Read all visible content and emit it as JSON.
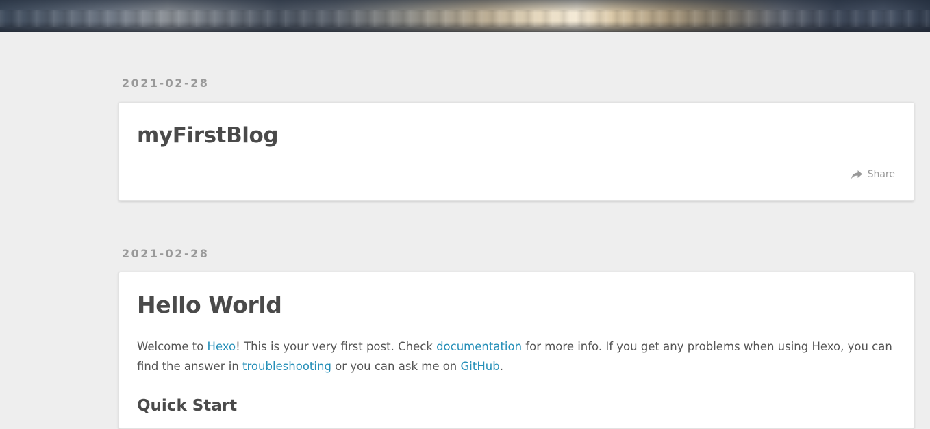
{
  "posts": [
    {
      "date": "2021-02-28",
      "title": "myFirstBlog",
      "share_label": "Share"
    },
    {
      "date": "2021-02-28",
      "title": "Hello World",
      "intro": {
        "t1": "Welcome to ",
        "link_hexo": "Hexo",
        "t2": "! This is your very first post. Check ",
        "link_docs": "documentation",
        "t3": " for more info. If you get any problems when using Hexo, you can find the answer in ",
        "link_troubleshooting": "troubleshooting",
        "t4": " or you can ask me on ",
        "link_github": "GitHub",
        "t5": "."
      },
      "section_heading": "Quick Start"
    }
  ],
  "colors": {
    "background": "#eeeeee",
    "card": "#ffffff",
    "link": "#258fb8",
    "date": "#999999",
    "title": "#4a4a4a"
  },
  "icons": {
    "share": "share-icon"
  }
}
